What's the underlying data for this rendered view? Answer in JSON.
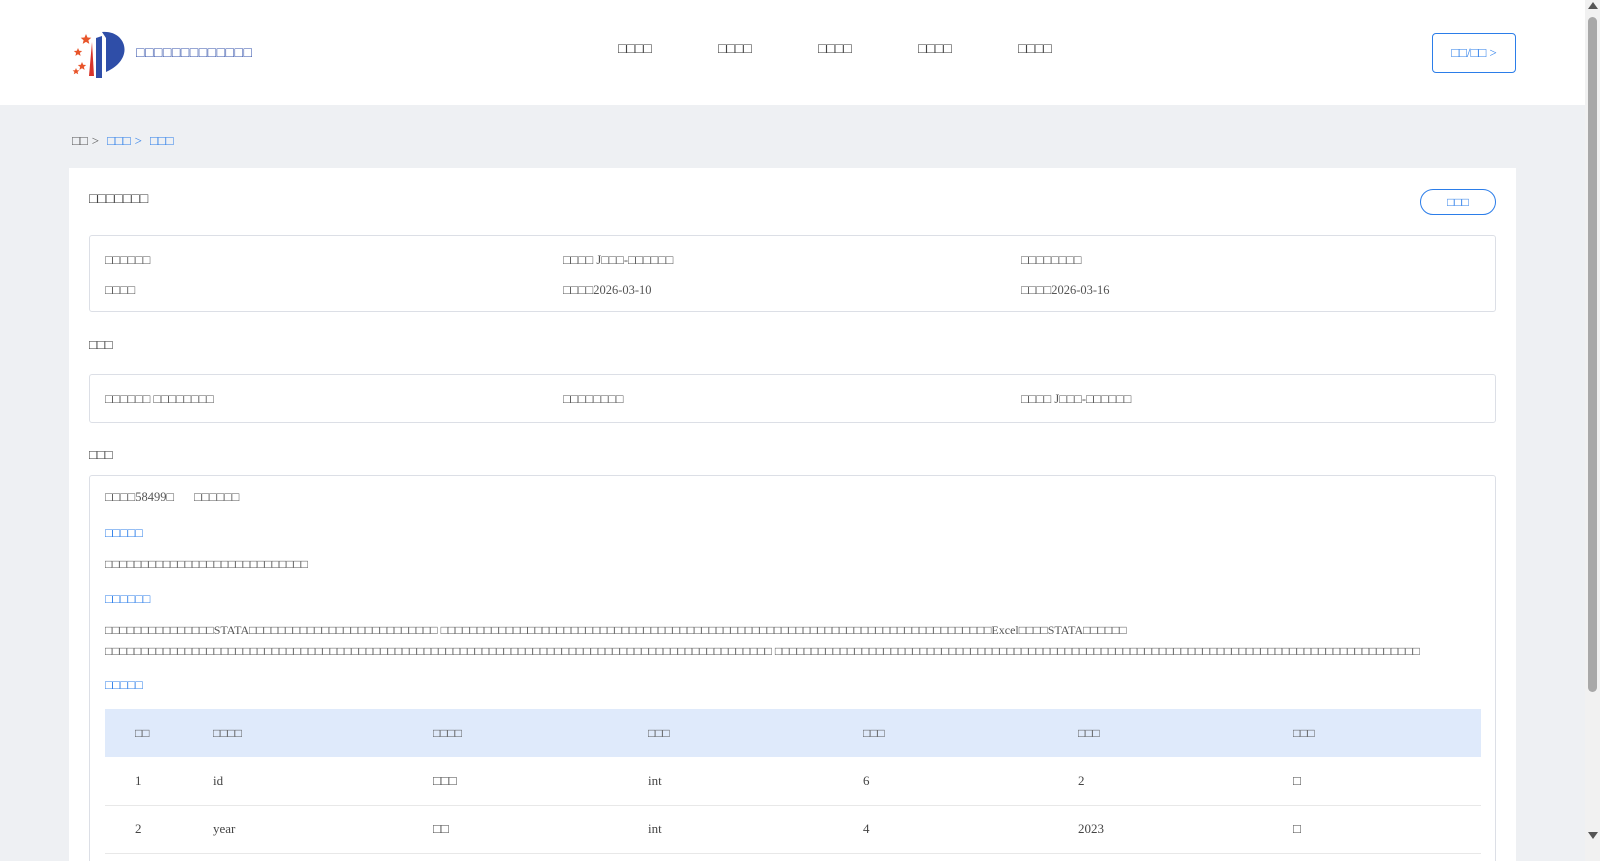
{
  "header": {
    "logo_text": "□□□□□□□□□□□□□",
    "nav": [
      "□□□□",
      "□□□□",
      "□□□□",
      "□□□□",
      "□□□□"
    ],
    "login_label": "□□/□□ >"
  },
  "breadcrumb": {
    "home": "□□",
    "sep": ">",
    "level2": "□□□",
    "level3": "□□□"
  },
  "card": {
    "title": "□□□□□□□",
    "action_label": "□□□",
    "info_rows": [
      [
        "□□□□□□",
        "□□□□ J□□□-□□□□□□",
        "□□□□□□□□"
      ],
      [
        "□□□□",
        "□□□□2026-03-10",
        "□□□□2026-03-16"
      ]
    ],
    "section1_label": "□□□",
    "section1_row": [
      "□□□□□□ □□□□□□□□",
      "□□□□□□□□",
      "□□□□ J□□□-□□□□□□"
    ],
    "section2_label": "□□□",
    "meta": [
      "□□□□58499□",
      "□□□□□□"
    ],
    "sub1": "□□□□□",
    "para1": "□□□□□□□□□□□□□□□□□□□□□□□□□□□□",
    "sub2": "□□□□□□",
    "para2": "□□□□□□□□□□□□□□□STATA□□□□□□□□□□□□□□□□□□□□□□□□□□ □□□□□□□□□□□□□□□□□□□□□□□□□□□□□□□□□□□□□□□□□□□□□□□□□□□□□□□□□□□□□□□□□□□□□□□□□□□□Excel□□□□STATA□□□□□□ □□□□□□□□□□□□□□□□□□□□□□□□□□□□□□□□□□□□□□□□□□□□□□□□□□□□□□□□□□□□□□□□□□□□□□□□□□□□□□□□□□□□□□□□□□□□ □□□□□□□□□□□□□□□□□□□□□□□□□□□□□□□□□□□□□□□□□□□□□□□□□□□□□□□□□□□□□□□□□□□□□□□□□□□□□□□□□□□□□□□□□",
    "sub3": "□□□□□",
    "table": {
      "headers": [
        "□□",
        "□□□□",
        "□□□□",
        "□□□",
        "□□□",
        "□□□",
        "□□□"
      ],
      "rows": [
        [
          "1",
          "id",
          "□□□",
          "int",
          "6",
          "2",
          "□"
        ],
        [
          "2",
          "year",
          "□□",
          "int",
          "4",
          "2023",
          "□"
        ]
      ]
    }
  }
}
